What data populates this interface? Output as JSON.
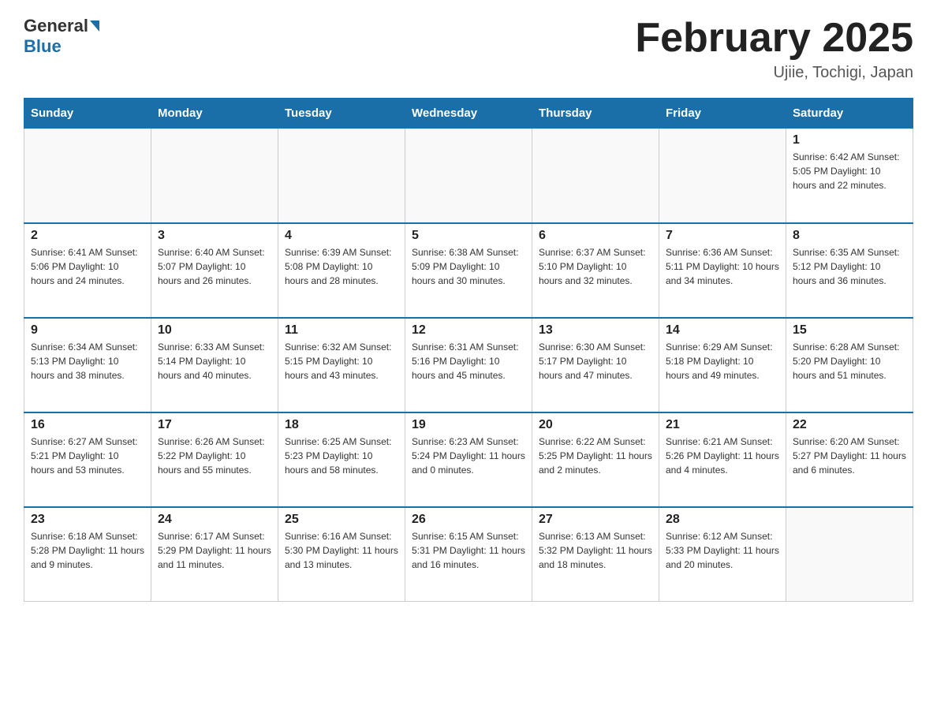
{
  "header": {
    "logo_general": "General",
    "logo_blue": "Blue",
    "title": "February 2025",
    "location": "Ujiie, Tochigi, Japan"
  },
  "days_of_week": [
    "Sunday",
    "Monday",
    "Tuesday",
    "Wednesday",
    "Thursday",
    "Friday",
    "Saturday"
  ],
  "weeks": [
    [
      {
        "day": "",
        "info": ""
      },
      {
        "day": "",
        "info": ""
      },
      {
        "day": "",
        "info": ""
      },
      {
        "day": "",
        "info": ""
      },
      {
        "day": "",
        "info": ""
      },
      {
        "day": "",
        "info": ""
      },
      {
        "day": "1",
        "info": "Sunrise: 6:42 AM\nSunset: 5:05 PM\nDaylight: 10 hours and 22 minutes."
      }
    ],
    [
      {
        "day": "2",
        "info": "Sunrise: 6:41 AM\nSunset: 5:06 PM\nDaylight: 10 hours and 24 minutes."
      },
      {
        "day": "3",
        "info": "Sunrise: 6:40 AM\nSunset: 5:07 PM\nDaylight: 10 hours and 26 minutes."
      },
      {
        "day": "4",
        "info": "Sunrise: 6:39 AM\nSunset: 5:08 PM\nDaylight: 10 hours and 28 minutes."
      },
      {
        "day": "5",
        "info": "Sunrise: 6:38 AM\nSunset: 5:09 PM\nDaylight: 10 hours and 30 minutes."
      },
      {
        "day": "6",
        "info": "Sunrise: 6:37 AM\nSunset: 5:10 PM\nDaylight: 10 hours and 32 minutes."
      },
      {
        "day": "7",
        "info": "Sunrise: 6:36 AM\nSunset: 5:11 PM\nDaylight: 10 hours and 34 minutes."
      },
      {
        "day": "8",
        "info": "Sunrise: 6:35 AM\nSunset: 5:12 PM\nDaylight: 10 hours and 36 minutes."
      }
    ],
    [
      {
        "day": "9",
        "info": "Sunrise: 6:34 AM\nSunset: 5:13 PM\nDaylight: 10 hours and 38 minutes."
      },
      {
        "day": "10",
        "info": "Sunrise: 6:33 AM\nSunset: 5:14 PM\nDaylight: 10 hours and 40 minutes."
      },
      {
        "day": "11",
        "info": "Sunrise: 6:32 AM\nSunset: 5:15 PM\nDaylight: 10 hours and 43 minutes."
      },
      {
        "day": "12",
        "info": "Sunrise: 6:31 AM\nSunset: 5:16 PM\nDaylight: 10 hours and 45 minutes."
      },
      {
        "day": "13",
        "info": "Sunrise: 6:30 AM\nSunset: 5:17 PM\nDaylight: 10 hours and 47 minutes."
      },
      {
        "day": "14",
        "info": "Sunrise: 6:29 AM\nSunset: 5:18 PM\nDaylight: 10 hours and 49 minutes."
      },
      {
        "day": "15",
        "info": "Sunrise: 6:28 AM\nSunset: 5:20 PM\nDaylight: 10 hours and 51 minutes."
      }
    ],
    [
      {
        "day": "16",
        "info": "Sunrise: 6:27 AM\nSunset: 5:21 PM\nDaylight: 10 hours and 53 minutes."
      },
      {
        "day": "17",
        "info": "Sunrise: 6:26 AM\nSunset: 5:22 PM\nDaylight: 10 hours and 55 minutes."
      },
      {
        "day": "18",
        "info": "Sunrise: 6:25 AM\nSunset: 5:23 PM\nDaylight: 10 hours and 58 minutes."
      },
      {
        "day": "19",
        "info": "Sunrise: 6:23 AM\nSunset: 5:24 PM\nDaylight: 11 hours and 0 minutes."
      },
      {
        "day": "20",
        "info": "Sunrise: 6:22 AM\nSunset: 5:25 PM\nDaylight: 11 hours and 2 minutes."
      },
      {
        "day": "21",
        "info": "Sunrise: 6:21 AM\nSunset: 5:26 PM\nDaylight: 11 hours and 4 minutes."
      },
      {
        "day": "22",
        "info": "Sunrise: 6:20 AM\nSunset: 5:27 PM\nDaylight: 11 hours and 6 minutes."
      }
    ],
    [
      {
        "day": "23",
        "info": "Sunrise: 6:18 AM\nSunset: 5:28 PM\nDaylight: 11 hours and 9 minutes."
      },
      {
        "day": "24",
        "info": "Sunrise: 6:17 AM\nSunset: 5:29 PM\nDaylight: 11 hours and 11 minutes."
      },
      {
        "day": "25",
        "info": "Sunrise: 6:16 AM\nSunset: 5:30 PM\nDaylight: 11 hours and 13 minutes."
      },
      {
        "day": "26",
        "info": "Sunrise: 6:15 AM\nSunset: 5:31 PM\nDaylight: 11 hours and 16 minutes."
      },
      {
        "day": "27",
        "info": "Sunrise: 6:13 AM\nSunset: 5:32 PM\nDaylight: 11 hours and 18 minutes."
      },
      {
        "day": "28",
        "info": "Sunrise: 6:12 AM\nSunset: 5:33 PM\nDaylight: 11 hours and 20 minutes."
      },
      {
        "day": "",
        "info": ""
      }
    ]
  ]
}
